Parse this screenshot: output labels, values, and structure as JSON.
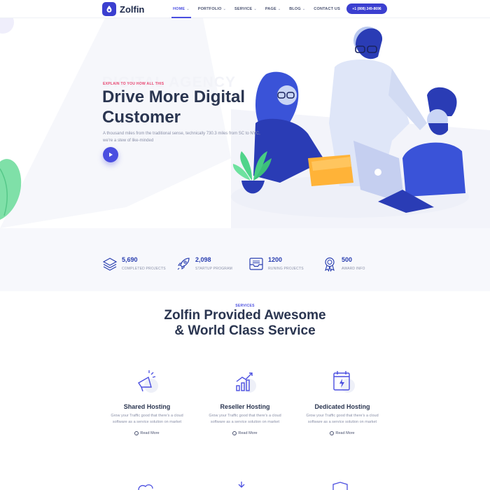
{
  "nav": {
    "logo_text": "Zolfin",
    "items": [
      {
        "label": "HOME",
        "active": true,
        "dropdown": true
      },
      {
        "label": "PORTFOLIO",
        "active": false,
        "dropdown": true
      },
      {
        "label": "SERVICE",
        "active": false,
        "dropdown": true
      },
      {
        "label": "PAGE",
        "active": false,
        "dropdown": true
      },
      {
        "label": "BLOG",
        "active": false,
        "dropdown": true
      },
      {
        "label": "CONTACT US",
        "active": false,
        "dropdown": false
      }
    ],
    "phone": "+1 (808) 249-8696"
  },
  "hero": {
    "background_word": "DIGITAL AGENCY",
    "kicker": "EXPLAIN TO YOU HOW ALL THIS",
    "title": "Drive More Digital Customer",
    "description": "A thousand miles from the traditional sense, technically 730.3 miles from SC to NYC, we're a stew of like-minded",
    "play_icon": "play-icon"
  },
  "stats": [
    {
      "value": "5,690",
      "label": "COMPLETED PROJECTS",
      "icon": "layers-icon"
    },
    {
      "value": "2,098",
      "label": "STARTUP PROGRAM",
      "icon": "rocket-icon"
    },
    {
      "value": "1200",
      "label": "RUNING PROJECTS",
      "icon": "inbox-icon"
    },
    {
      "value": "500",
      "label": "AWARD INFO",
      "icon": "award-icon"
    }
  ],
  "services": {
    "kicker": "SERVICES",
    "title_line1": "Zolfin Provided Awesome",
    "title_line2": "& World Class Service",
    "cards": [
      {
        "title": "Shared Hosting",
        "desc": "Grow your Traffic good that there's a cloud software as a service solution on market",
        "link": "Read More",
        "icon": "megaphone-icon"
      },
      {
        "title": "Reseller Hosting",
        "desc": "Grow your Traffic good that there's a cloud software as a service solution on market",
        "link": "Read More",
        "icon": "chart-growth-icon"
      },
      {
        "title": "Dedicated Hosting",
        "desc": "Grow your Traffic good that there's a cloud software as a service solution on market",
        "link": "Read More",
        "icon": "calendar-bolt-icon"
      }
    ]
  },
  "colors": {
    "accent": "#4a4ee0",
    "brand_dark": "#3b3fd0",
    "kicker_red": "#e8406c",
    "heading": "#2a3550",
    "muted": "#8a90a8",
    "stats_bg": "#f7f8fc"
  }
}
